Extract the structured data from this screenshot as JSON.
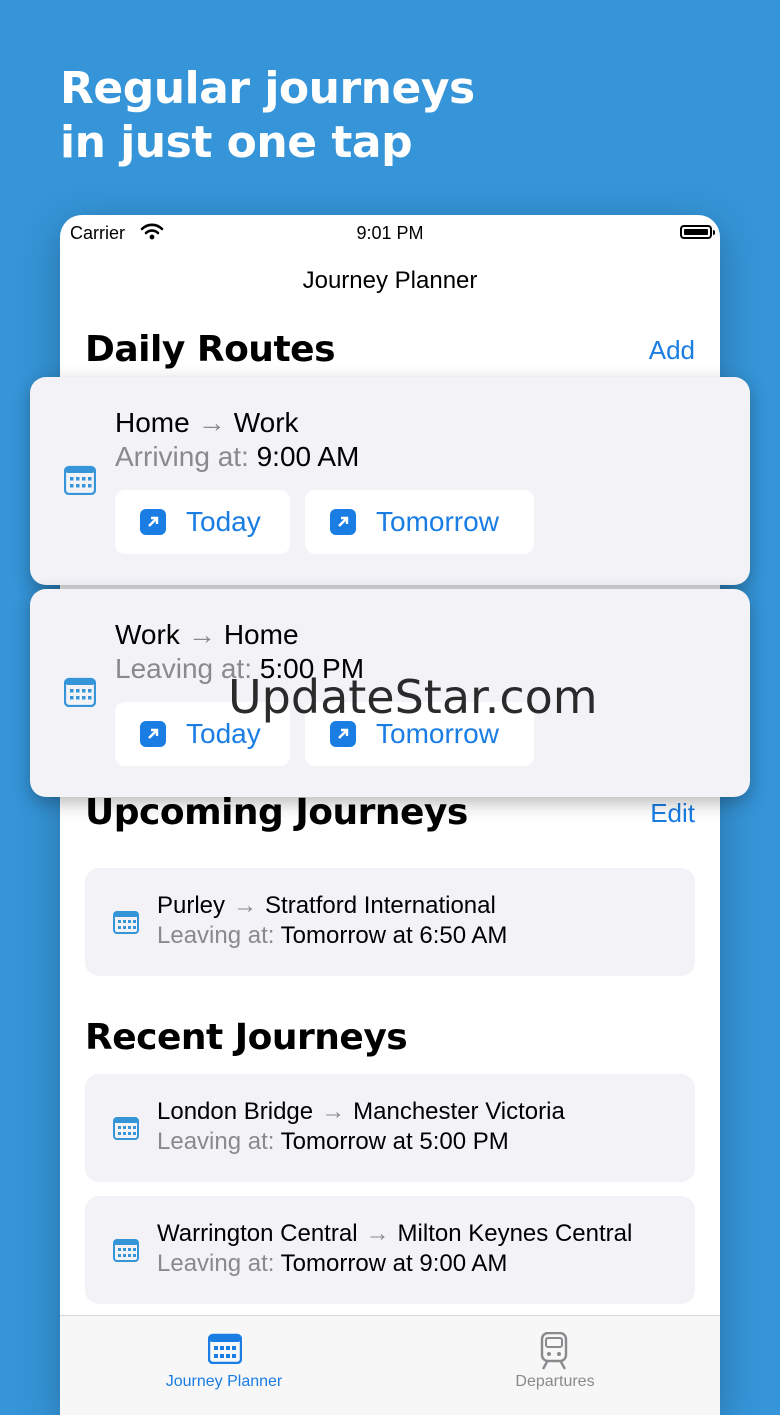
{
  "headline": {
    "line1": "Regular journeys",
    "line2": "in just one tap"
  },
  "status_bar": {
    "carrier": "Carrier",
    "time": "9:01 PM"
  },
  "nav": {
    "title": "Journey Planner"
  },
  "daily_routes": {
    "title": "Daily Routes",
    "action": "Add",
    "items": [
      {
        "from": "Home",
        "to": "Work",
        "label": "Arriving at:",
        "time": "9:00 AM",
        "today": "Today",
        "tomorrow": "Tomorrow"
      },
      {
        "from": "Work",
        "to": "Home",
        "label": "Leaving at:",
        "time": "5:00 PM",
        "today": "Today",
        "tomorrow": "Tomorrow"
      }
    ]
  },
  "upcoming": {
    "title": "Upcoming Journeys",
    "action": "Edit",
    "items": [
      {
        "from": "Purley",
        "to": "Stratford International",
        "label": "Leaving at:",
        "time": "Tomorrow at 6:50 AM"
      }
    ]
  },
  "recent": {
    "title": "Recent Journeys",
    "items": [
      {
        "from": "London Bridge",
        "to": "Manchester Victoria",
        "label": "Leaving at:",
        "time": "Tomorrow at 5:00 PM"
      },
      {
        "from": "Warrington Central",
        "to": "Milton Keynes Central",
        "label": "Leaving at:",
        "time": "Tomorrow at 9:00 AM"
      }
    ]
  },
  "arrow_glyph": "→",
  "watermark": "UpdateStar.com",
  "tabs": [
    {
      "label": "Journey Planner",
      "icon": "calendar-icon",
      "active": true
    },
    {
      "label": "Departures",
      "icon": "train-icon",
      "active": false
    }
  ],
  "colors": {
    "background": "#3595d8",
    "accent": "#1a7de4",
    "secondary_text": "#8a8a8e",
    "card": "#f2f2f7"
  }
}
